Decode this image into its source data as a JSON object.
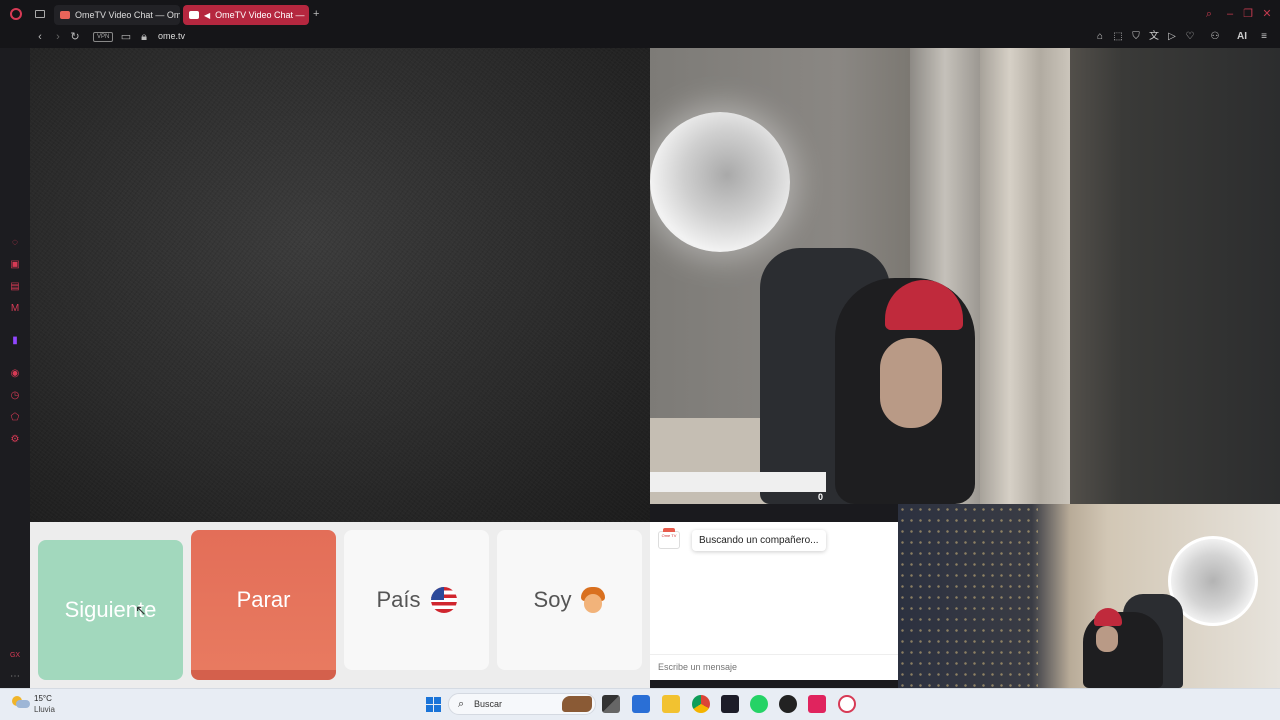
{
  "browser": {
    "tabs": [
      {
        "label": "OmeTV Video Chat — Om",
        "active": false
      },
      {
        "label": "OmeTV Video Chat —",
        "active": true
      }
    ],
    "new_tab_symbol": "+",
    "url": "ome.tv",
    "vpn_label": "VPN",
    "ai_label": "AI",
    "accent_color": "#d73a55"
  },
  "video": {
    "viewer_count": "0"
  },
  "controls": {
    "next_label": "Siguiente",
    "stop_label": "Parar",
    "country_label": "País",
    "gender_label": "Soy"
  },
  "chat": {
    "status": "Buscando un compañero...",
    "input_placeholder": "Escribe un mensaje",
    "logo_text": "Ome TV"
  },
  "taskbar": {
    "temperature": "15°C",
    "condition": "Lluvia",
    "search_label": "Buscar"
  },
  "colors": {
    "next_button": "#a2d8bd",
    "stop_button": "#e36e58",
    "neutral_button": "#f8f8f8"
  }
}
